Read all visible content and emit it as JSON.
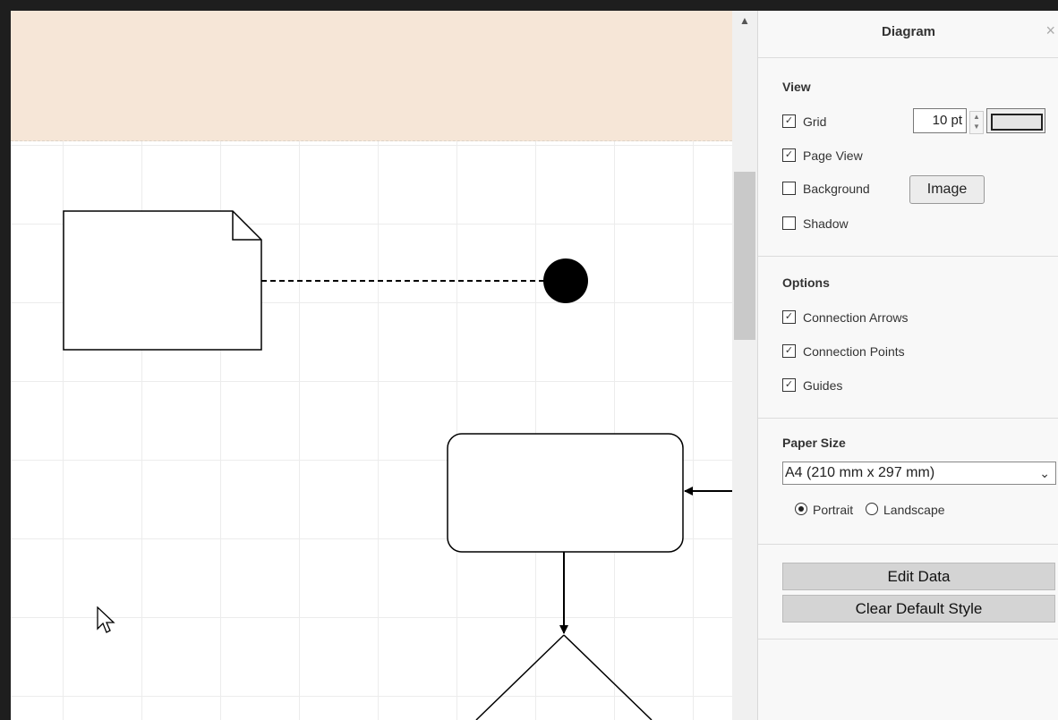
{
  "panel": {
    "title": "Diagram",
    "close_icon": "×",
    "view": {
      "title": "View",
      "grid_label": "Grid",
      "grid_checked": true,
      "grid_size": "10 pt",
      "page_view_label": "Page View",
      "page_view_checked": true,
      "background_label": "Background",
      "background_checked": false,
      "image_button": "Image",
      "shadow_label": "Shadow",
      "shadow_checked": false
    },
    "options": {
      "title": "Options",
      "connection_arrows_label": "Connection Arrows",
      "connection_points_label": "Connection Points",
      "guides_label": "Guides"
    },
    "paper": {
      "title": "Paper Size",
      "selected": "A4 (210 mm x 297 mm)",
      "portrait_label": "Portrait",
      "landscape_label": "Landscape",
      "orientation": "Portrait"
    },
    "edit_data_button": "Edit Data",
    "clear_default_style_button": "Clear Default Style"
  },
  "colors": {
    "page_shade": "#f6e6d7",
    "panel_bg": "#f8f8f8",
    "frame": "#1e1e1e"
  }
}
